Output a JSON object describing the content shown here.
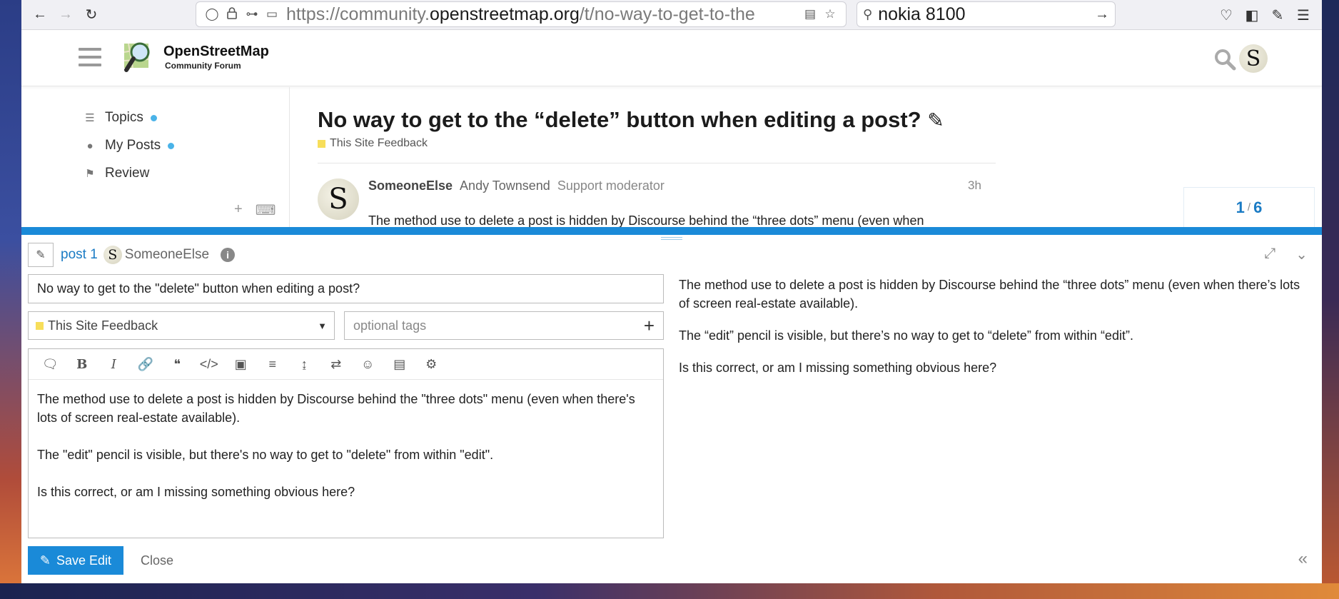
{
  "browser": {
    "url_prefix": "https://community.",
    "url_host": "openstreetmap.org",
    "url_path": "/t/no-way-to-get-to-the",
    "search_text": "nokia 8100"
  },
  "header": {
    "site_title": "OpenStreetMap",
    "site_subtitle": "Community Forum",
    "avatar_letter": "S"
  },
  "sidebar": {
    "items": [
      {
        "label": "Topics",
        "icon": "layers-icon"
      },
      {
        "label": "My Posts",
        "icon": "user-icon"
      },
      {
        "label": "Review",
        "icon": "flag-icon"
      }
    ]
  },
  "topic": {
    "title": "No way to get to the “delete” button when editing a post?",
    "category": "This Site Feedback",
    "category_color": "#f7de5a",
    "post": {
      "username": "SomeoneElse",
      "full_name": "Andy Townsend",
      "user_title": "Support moderator",
      "time": "3h",
      "avatar_letter": "S",
      "peek_text": "The method use to delete a post is hidden by Discourse behind the “three dots” menu (even when"
    },
    "timeline": {
      "current": "1",
      "total": "6"
    }
  },
  "composer": {
    "post_link": "post 1",
    "username": "SomeoneElse",
    "avatar_letter": "S",
    "title_value": "No way to get to the \"delete\" button when editing a post?",
    "category_value": "This Site Feedback",
    "tags_placeholder": "optional tags",
    "editor_paragraphs": [
      "The method use to delete a post is hidden by Discourse behind the \"three dots\" menu (even when there's lots of screen real-estate available).",
      "The \"edit\" pencil is visible, but there's no way to get to \"delete\" from within \"edit\".",
      "Is this correct, or am I missing something obvious here?"
    ],
    "preview_paragraphs": [
      "The method use to delete a post is hidden by Discourse behind the “three dots” menu (even when there’s lots of screen real-estate available).",
      "The “edit” pencil is visible, but there’s no way to get to “delete” from within “edit”.",
      "Is this correct, or am I missing something obvious here?"
    ],
    "save_label": "Save Edit",
    "close_label": "Close",
    "accent_color": "#1a8ad8"
  }
}
